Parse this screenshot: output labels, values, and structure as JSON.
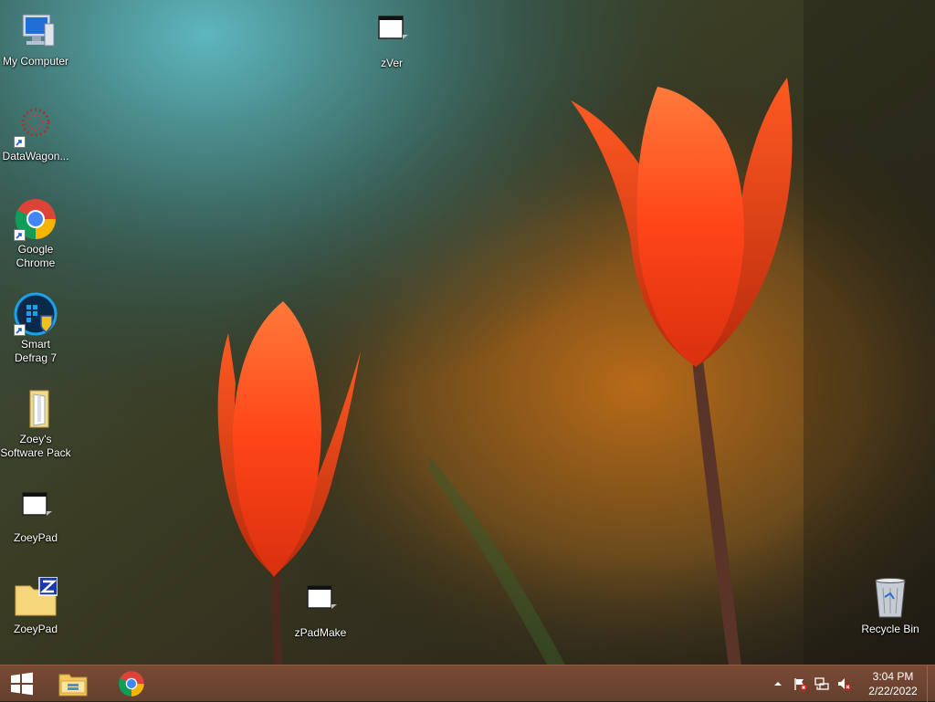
{
  "desktop": {
    "icons": [
      {
        "label": "My Computer",
        "icon": "computer-icon"
      },
      {
        "label": "DataWagon...",
        "icon": "datawagon-icon"
      },
      {
        "label": "Google Chrome",
        "icon": "chrome-icon"
      },
      {
        "label": "Smart Defrag 7",
        "icon": "smart-defrag-icon"
      },
      {
        "label": "Zoey's Software Pack",
        "icon": "folder-icon"
      },
      {
        "label": "ZoeyPad",
        "icon": "application-window-icon"
      },
      {
        "label": "ZoeyPad",
        "icon": "folder-z-icon"
      },
      {
        "label": "zVer",
        "icon": "application-window-icon"
      },
      {
        "label": "zPadMake",
        "icon": "application-window-icon"
      },
      {
        "label": "Recycle Bin",
        "icon": "recycle-bin-icon"
      }
    ]
  },
  "taskbar": {
    "pinned": [
      {
        "name": "start",
        "icon": "windows-logo-icon"
      },
      {
        "name": "file-explorer",
        "icon": "file-explorer-icon"
      },
      {
        "name": "google-chrome",
        "icon": "chrome-icon"
      }
    ],
    "tray": {
      "icons": [
        "show-hidden-icons-arrow",
        "action-center-flag-icon",
        "network-icon",
        "volume-muted-icon"
      ],
      "time": "3:04 PM",
      "date": "2/22/2022"
    }
  },
  "colors": {
    "taskbar": "#6e4532",
    "tulip": "#ff4a1c",
    "chrome_red": "#db4437",
    "chrome_green": "#0f9d58",
    "chrome_yellow": "#f4b400",
    "chrome_blue": "#4285f4"
  }
}
